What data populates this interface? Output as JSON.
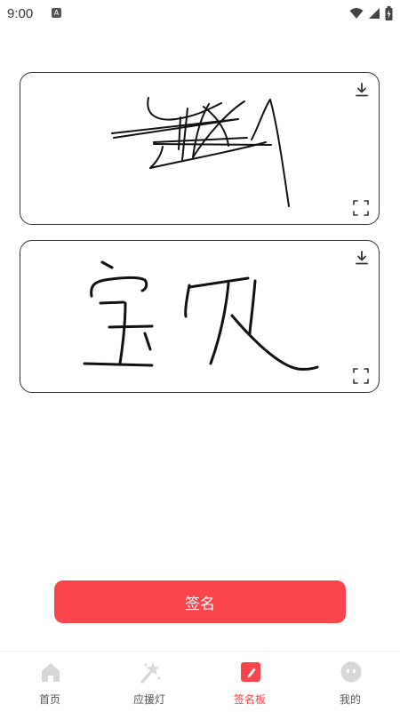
{
  "status_bar": {
    "time": "9:00",
    "notification_icon": "a-icon"
  },
  "signatures": [
    {
      "name": "signature-1",
      "actions": [
        "download-icon",
        "fullscreen-icon"
      ]
    },
    {
      "name": "signature-2",
      "actions": [
        "download-icon",
        "fullscreen-icon"
      ]
    }
  ],
  "sign_button_label": "签名",
  "tabs": [
    {
      "label": "首页",
      "icon": "home-icon",
      "active": false
    },
    {
      "label": "应援灯",
      "icon": "light-stick-icon",
      "active": false
    },
    {
      "label": "签名板",
      "icon": "signature-pen-icon",
      "active": true
    },
    {
      "label": "我的",
      "icon": "profile-face-icon",
      "active": false
    }
  ],
  "colors": {
    "accent": "#f8444a",
    "inactive_icon": "#d7d7d7",
    "stroke": "#111111"
  }
}
